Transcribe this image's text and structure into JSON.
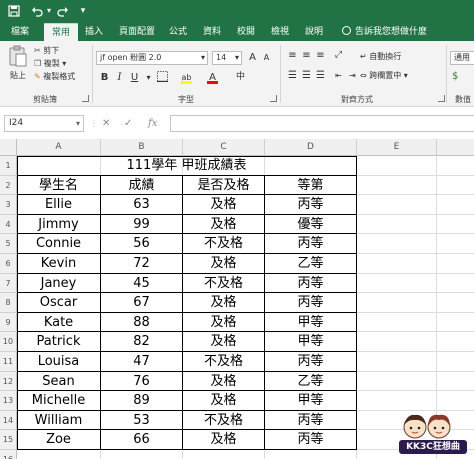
{
  "quick_access": {
    "save_icon": "save-icon",
    "undo_icon": "undo-icon",
    "redo_icon": "redo-icon"
  },
  "tabs": [
    "檔案",
    "常用",
    "插入",
    "頁面配置",
    "公式",
    "資料",
    "校閱",
    "檢視",
    "說明"
  ],
  "active_tab": "常用",
  "tell_me": "告訴我您想做什麼",
  "ribbon": {
    "clipboard": {
      "paste": "貼上",
      "cut": "剪下",
      "copy": "複製",
      "format_painter": "複製格式",
      "label": "剪貼簿"
    },
    "font": {
      "name": "jf open 粉圓 2.0",
      "size": "14",
      "bold": "B",
      "italic": "I",
      "underline": "U",
      "grow": "A",
      "shrink": "A",
      "font_color": "A",
      "highlight": "ab",
      "phonetic": "中",
      "label": "字型"
    },
    "alignment": {
      "wrap_text": "自動換行",
      "merge_center": "跨欄置中",
      "label": "對齊方式"
    },
    "number": {
      "format": "通用",
      "label": "數值"
    }
  },
  "formula_bar": {
    "name_box": "I24",
    "cancel": "✕",
    "enter": "✓",
    "fx": "fx",
    "value": ""
  },
  "columns": [
    "A",
    "B",
    "C",
    "D",
    "E"
  ],
  "rows": [
    "1",
    "2",
    "3",
    "4",
    "5",
    "6",
    "7",
    "8",
    "9",
    "10",
    "11",
    "12",
    "13",
    "14",
    "15",
    "16"
  ],
  "sheet": {
    "title": "111學年 甲班成績表",
    "headers": [
      "學生名",
      "成績",
      "是否及格",
      "等第"
    ],
    "records": [
      [
        "Ellie",
        "63",
        "及格",
        "丙等"
      ],
      [
        "Jimmy",
        "99",
        "及格",
        "優等"
      ],
      [
        "Connie",
        "56",
        "不及格",
        "丙等"
      ],
      [
        "Kevin",
        "72",
        "及格",
        "乙等"
      ],
      [
        "Janey",
        "45",
        "不及格",
        "丙等"
      ],
      [
        "Oscar",
        "67",
        "及格",
        "丙等"
      ],
      [
        "Kate",
        "88",
        "及格",
        "甲等"
      ],
      [
        "Patrick",
        "82",
        "及格",
        "甲等"
      ],
      [
        "Louisa",
        "47",
        "不及格",
        "丙等"
      ],
      [
        "Sean",
        "76",
        "及格",
        "乙等"
      ],
      [
        "Michelle",
        "89",
        "及格",
        "甲等"
      ],
      [
        "William",
        "53",
        "不及格",
        "丙等"
      ],
      [
        "Zoe",
        "66",
        "及格",
        "丙等"
      ]
    ]
  },
  "watermark": "KK3C狂想曲",
  "colors": {
    "excel_green": "#217346",
    "ribbon_bg": "#f3f3f3"
  }
}
